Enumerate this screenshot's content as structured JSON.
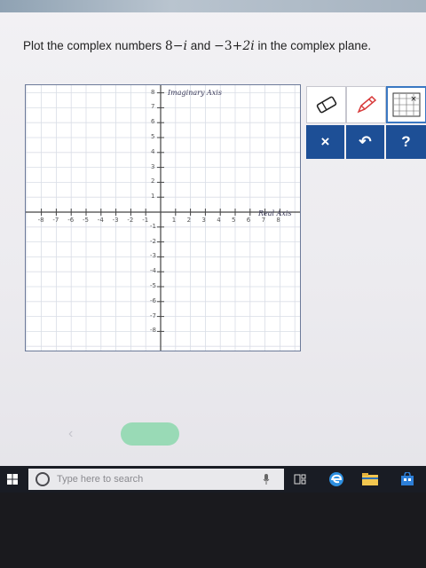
{
  "question": {
    "prefix": "Plot the complex numbers ",
    "num1_real": "8",
    "num1_op": "−",
    "num1_imag": "i",
    "joiner": " and ",
    "num2_real": "−3",
    "num2_op": "+",
    "num2_imag": "2i",
    "suffix": " in the complex plane."
  },
  "graph": {
    "y_axis_label": "Imaginary Axis",
    "x_axis_label": "Real Axis",
    "x_tick_labels": [
      "-8",
      "-7",
      "-6",
      "-5",
      "-4",
      "-3",
      "-2",
      "-1",
      "1",
      "2",
      "3",
      "4",
      "5",
      "6",
      "7",
      "8"
    ],
    "y_tick_labels_positive": [
      "8",
      "7",
      "6",
      "5",
      "4",
      "3",
      "2",
      "1"
    ],
    "y_tick_labels_negative": [
      "-1",
      "-2",
      "-3",
      "-4",
      "-5",
      "-6",
      "-7",
      "-8"
    ],
    "xlim": [
      -8,
      8
    ],
    "ylim": [
      -8,
      8
    ],
    "grid": true
  },
  "toolbar": {
    "tools": [
      "eraser-icon",
      "pencil-icon",
      "point-plot-icon"
    ],
    "actions": [
      {
        "name": "clear",
        "label": "×"
      },
      {
        "name": "undo",
        "label": "↶"
      },
      {
        "name": "help",
        "label": "?"
      }
    ],
    "accent": "#1d4f96"
  },
  "taskbar": {
    "search_placeholder": "Type here to search"
  }
}
